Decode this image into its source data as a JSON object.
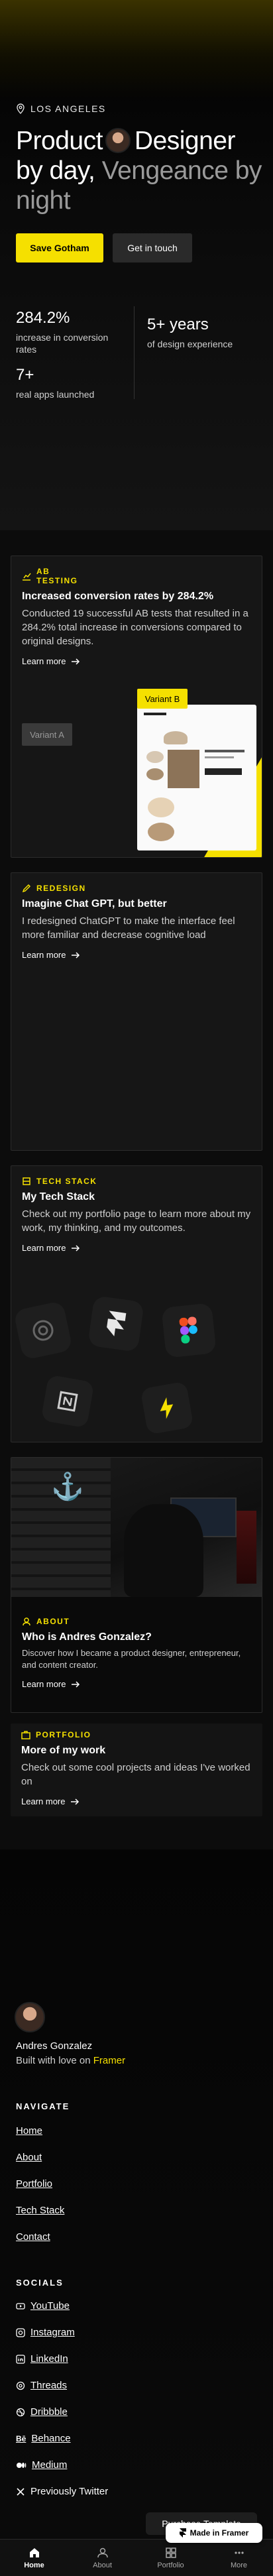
{
  "hero": {
    "location": "LOS ANGELES",
    "headline_a": "Product",
    "headline_b": "Designer by day,",
    "headline_c": "Vengeance by night",
    "primary_btn": "Save Gotham",
    "secondary_btn": "Get in touch",
    "stats": [
      {
        "value": "284.2%",
        "label": "increase in conversion rates"
      },
      {
        "value": "5+ years",
        "label": "of design experience"
      },
      {
        "value": "7+",
        "label": "real apps launched"
      }
    ]
  },
  "cards": {
    "ab": {
      "tag": "AB TESTING",
      "title": "Increased conversion rates by 284.2%",
      "desc": "Conducted 19 successful AB tests that resulted in a 284.2% total increase in conversions compared to original designs.",
      "more": "Learn more",
      "variant_a": "Variant A",
      "variant_b": "Variant B"
    },
    "redesign": {
      "tag": "REDESIGN",
      "title": "Imagine Chat GPT, but better",
      "desc": "I redesigned ChatGPT to make the interface feel more familiar and decrease cognitive load",
      "more": "Learn more"
    },
    "tech": {
      "tag": "TECH STACK",
      "title": "My Tech Stack",
      "desc": "Check out my portfolio page to learn more about my work, my thinking, and my outcomes.",
      "more": "Learn more"
    },
    "about": {
      "tag": "ABOUT",
      "title": "Who is Andres Gonzalez?",
      "desc": "Discover how I became a product designer, entrepreneur, and content creator.",
      "more": "Learn more"
    },
    "portfolio": {
      "tag": "PORTFOLIO",
      "title": "More of my work",
      "desc": "Check out some cool projects and ideas I've worked on",
      "more": "Learn more"
    }
  },
  "footer": {
    "name": "Andres Gonzalez",
    "built_prefix": "Built with love on",
    "built_brand": "Framer",
    "nav_heading": "NAVIGATE",
    "nav": [
      "Home",
      "About",
      "Portfolio",
      "Tech Stack",
      "Contact"
    ],
    "socials_heading": "SOCIALS",
    "socials": [
      "YouTube",
      "Instagram",
      "LinkedIn",
      "Threads",
      "Dribbble",
      "Behance",
      "Medium",
      "Previously Twitter"
    ],
    "purchase": "Purchase Template",
    "made_in": "Made in Framer"
  },
  "bottom_nav": [
    "Home",
    "About",
    "Portfolio",
    "More"
  ],
  "colors": {
    "accent": "#f5e000",
    "bg": "#0c0c0c",
    "card": "#161616"
  }
}
